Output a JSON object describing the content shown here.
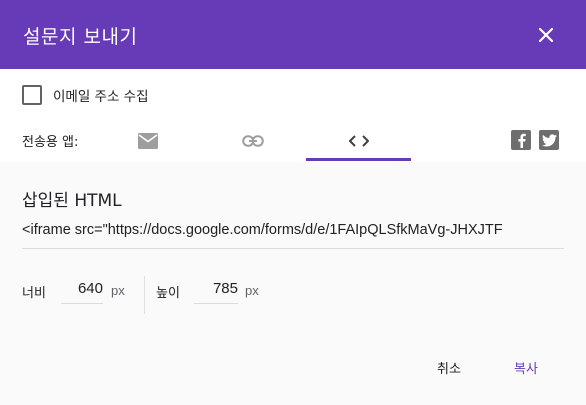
{
  "dialog": {
    "title": "설문지 보내기"
  },
  "options": {
    "collect_email_label": "이메일 주소 수집",
    "collect_email_checked": false
  },
  "send_via": {
    "label": "전송용 앱:",
    "tabs": [
      {
        "icon": "email-icon",
        "active": false
      },
      {
        "icon": "link-icon",
        "active": false
      },
      {
        "icon": "embed-code-icon",
        "active": true
      }
    ],
    "social": [
      {
        "icon": "facebook-icon"
      },
      {
        "icon": "twitter-icon"
      }
    ]
  },
  "embed": {
    "title": "삽입된 HTML",
    "code": "<iframe src=\"https://docs.google.com/forms/d/e/1FAIpQLSfkMaVg-JHXJTF",
    "width_label": "너비",
    "width_value": "640",
    "height_label": "높이",
    "height_value": "785",
    "unit": "px"
  },
  "actions": {
    "cancel_label": "취소",
    "copy_label": "복사"
  },
  "colors": {
    "accent": "#673ab7",
    "icon_gray": "#9e9e9e",
    "social_gray": "#6e6e6e"
  }
}
